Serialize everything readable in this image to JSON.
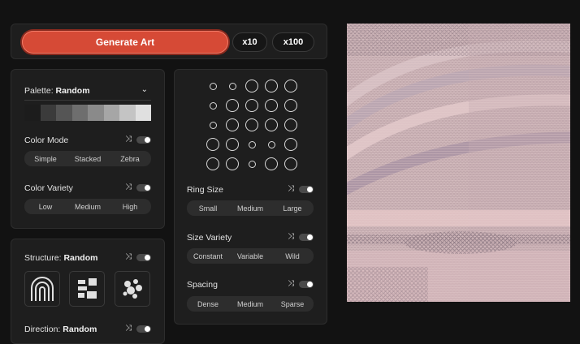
{
  "actions": {
    "generate_label": "Generate Art",
    "x10_label": "x10",
    "x100_label": "x100"
  },
  "palette": {
    "label": "Palette:",
    "value": "Random",
    "swatches": [
      "#1c1c1c",
      "#3b3b3b",
      "#555555",
      "#6e6e6e",
      "#8a8a8a",
      "#a6a6a6",
      "#c4c4c4",
      "#e0e0e0"
    ]
  },
  "color_mode": {
    "label": "Color Mode",
    "options": [
      "Simple",
      "Stacked",
      "Zebra"
    ]
  },
  "color_variety": {
    "label": "Color Variety",
    "options": [
      "Low",
      "Medium",
      "High"
    ]
  },
  "structure": {
    "label": "Structure:",
    "value": "Random",
    "icons": [
      "arch-icon",
      "blocks-icon",
      "dots-cluster-icon"
    ]
  },
  "direction": {
    "label": "Direction:",
    "value": "Random"
  },
  "ring_size": {
    "label": "Ring Size",
    "options": [
      "Small",
      "Medium",
      "Large"
    ]
  },
  "size_variety": {
    "label": "Size Variety",
    "options": [
      "Constant",
      "Variable",
      "Wild"
    ]
  },
  "spacing": {
    "label": "Spacing",
    "options": [
      "Dense",
      "Medium",
      "Sparse"
    ]
  },
  "ring_preview": {
    "rows": [
      [
        0,
        0,
        1,
        1,
        1
      ],
      [
        0,
        1,
        1,
        1,
        1
      ],
      [
        0,
        1,
        1,
        1,
        1
      ],
      [
        1,
        1,
        0,
        0,
        1
      ],
      [
        1,
        1,
        0,
        1,
        1
      ]
    ]
  },
  "colors": {
    "accent": "#d64a36",
    "bg": "#121212",
    "panel": "#1e1e1e"
  }
}
